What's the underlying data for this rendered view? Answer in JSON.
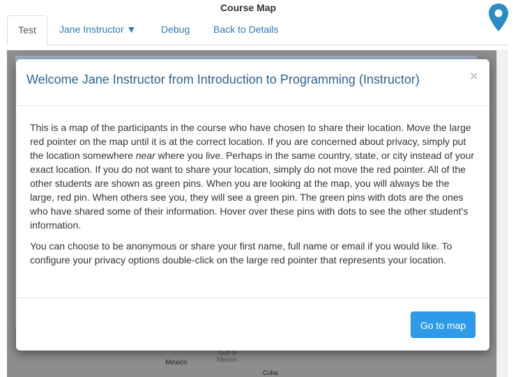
{
  "page": {
    "title": "Course Map"
  },
  "logo": {
    "icon": "map-pin-icon",
    "color": "#2b8cc4"
  },
  "tabs": [
    {
      "label": "Test",
      "active": true
    },
    {
      "label": "Jane Instructor ▼",
      "active": false
    },
    {
      "label": "Debug",
      "active": false
    },
    {
      "label": "Back to Details",
      "active": false
    }
  ],
  "map": {
    "labels": {
      "mexico": "Mexico",
      "gulf_line1": "Gulf of",
      "gulf_line2": "Mexico",
      "cuba": "Cuba"
    }
  },
  "modal": {
    "title": "Welcome Jane Instructor from Introduction to Programming (Instructor)",
    "close": "×",
    "paragraph1_before": "This is a map of the participants in the course who have chosen to share their location. Move the large red pointer on the map until it is at the correct location. If you are concerned about privacy, simply put the location somewhere ",
    "paragraph1_em": "near",
    "paragraph1_after": " where you live. Perhaps in the same country, state, or city instead of your exact location. If you do not want to share your location, simply do not move the red pointer. All of the other students are shown as green pins. When you are looking at the map, you will always be the large, red pin. When others see you, they will see a green pin. The green pins with dots are the ones who have shared some of their information. Hover over these pins with dots to see the other student's information.",
    "paragraph2": "You can choose to be anonymous or share your first name, full name or email if you would like. To configure your privacy options double-click on the large red pointer that represents your location.",
    "button_label": "Go to map"
  },
  "colors": {
    "link": "#337ab7",
    "title": "#2a6496",
    "primary_button": "#2f9be8"
  }
}
